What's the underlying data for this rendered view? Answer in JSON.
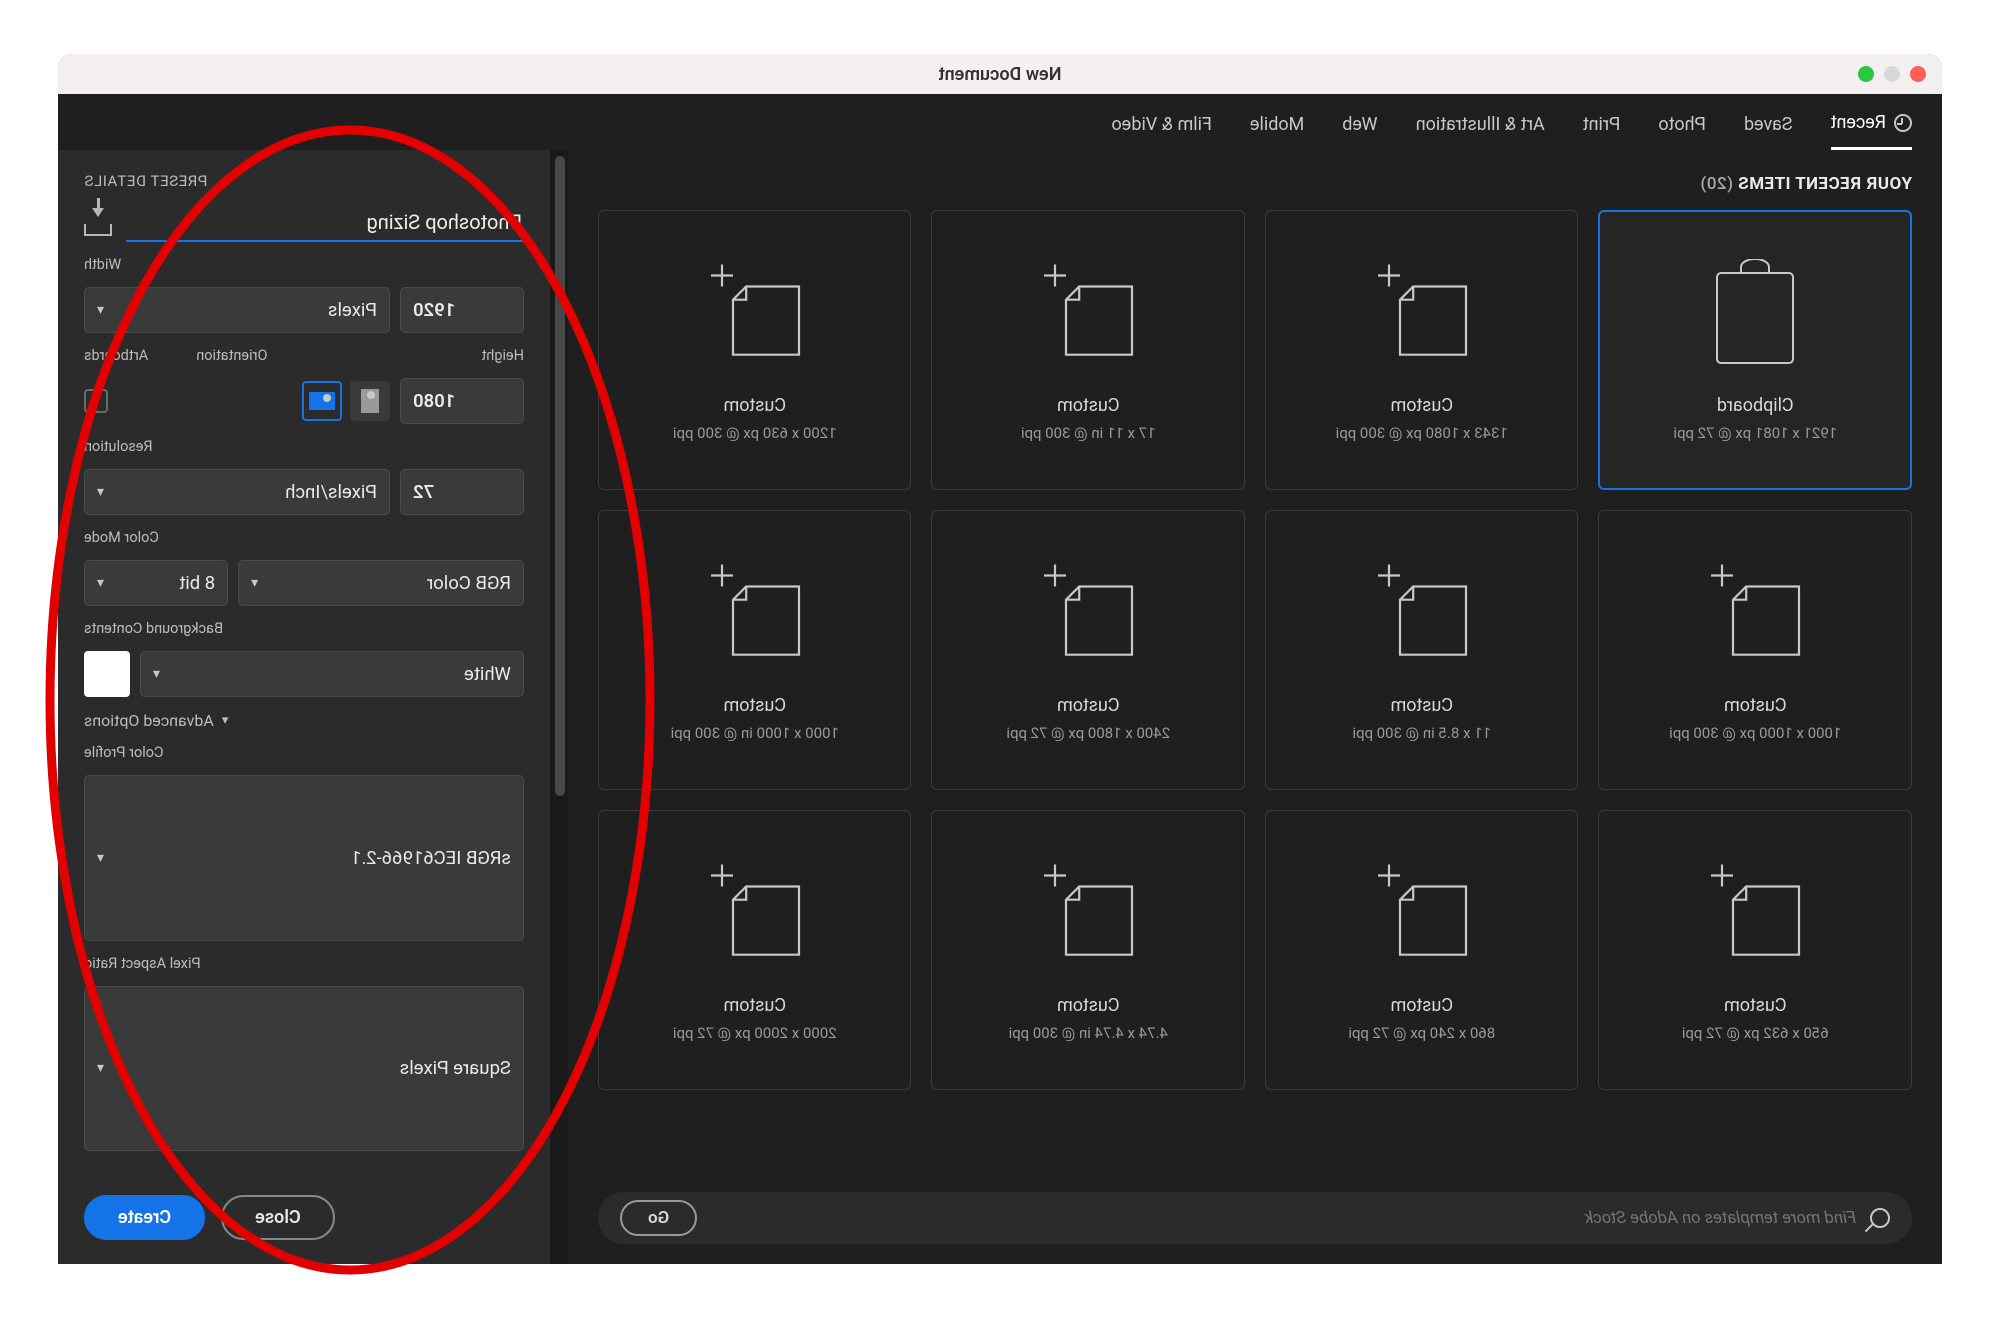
{
  "window": {
    "title": "New Document"
  },
  "tabs": [
    {
      "label": "Recent",
      "active": true
    },
    {
      "label": "Saved",
      "active": false
    },
    {
      "label": "Photo",
      "active": false
    },
    {
      "label": "Print",
      "active": false
    },
    {
      "label": "Art & Illustration",
      "active": false
    },
    {
      "label": "Web",
      "active": false
    },
    {
      "label": "Mobile",
      "active": false
    },
    {
      "label": "Film & Video",
      "active": false
    }
  ],
  "section": {
    "title": "YOUR RECENT ITEMS",
    "count": "(20)"
  },
  "cards": [
    {
      "name": "Clipboard",
      "dims": "1921 x 1081 px @ 72 ppi",
      "selected": true,
      "icon": "clip"
    },
    {
      "name": "Custom",
      "dims": "1343 x 1080 px @ 300 ppi",
      "selected": false,
      "icon": "page"
    },
    {
      "name": "Custom",
      "dims": "17 x 11 in @ 300 ppi",
      "selected": false,
      "icon": "page"
    },
    {
      "name": "Custom",
      "dims": "1200 x 630 px @ 300 ppi",
      "selected": false,
      "icon": "page"
    },
    {
      "name": "Custom",
      "dims": "1000 x 1000 px @ 300 ppi",
      "selected": false,
      "icon": "page"
    },
    {
      "name": "Custom",
      "dims": "11 x 8.5 in @ 300 ppi",
      "selected": false,
      "icon": "page"
    },
    {
      "name": "Custom",
      "dims": "2400 x 1800 px @ 72 ppi",
      "selected": false,
      "icon": "page"
    },
    {
      "name": "Custom",
      "dims": "1000 x 1000 in @ 300 ppi",
      "selected": false,
      "icon": "page"
    },
    {
      "name": "Custom",
      "dims": "650 x 632 px @ 72 ppi",
      "selected": false,
      "icon": "page"
    },
    {
      "name": "Custom",
      "dims": "860 x 240 px @ 72 ppi",
      "selected": false,
      "icon": "page"
    },
    {
      "name": "Custom",
      "dims": "4.74 x 4.74 in @ 300 ppi",
      "selected": false,
      "icon": "page"
    },
    {
      "name": "Custom",
      "dims": "2000 x 2000 px @ 72 ppi",
      "selected": false,
      "icon": "page"
    }
  ],
  "search": {
    "placeholder": "Find more templates on Adobe Stock",
    "go": "Go"
  },
  "details": {
    "header": "PRESET DETAILS",
    "preset_name": "Photoshop Sizing",
    "labels": {
      "width": "Width",
      "height": "Height",
      "orientation": "Orientation",
      "artboards": "Artboards",
      "resolution": "Resolution",
      "color_mode": "Color Mode",
      "background": "Background Contents",
      "advanced": "Advanced Options",
      "color_profile": "Color Profile",
      "pixel_aspect": "Pixel Aspect Ratio"
    },
    "width": {
      "value": "1920",
      "unit": "Pixels"
    },
    "height": {
      "value": "1080"
    },
    "orientation": "landscape",
    "artboards_checked": false,
    "resolution": {
      "value": "72",
      "unit": "Pixels/Inch"
    },
    "color_mode": {
      "mode": "RGB Color",
      "depth": "8 bit"
    },
    "background": "White",
    "color_profile": "sRGB IEC61966-2.1",
    "pixel_aspect": "Square Pixels"
  },
  "buttons": {
    "close": "Close",
    "create": "Create"
  }
}
